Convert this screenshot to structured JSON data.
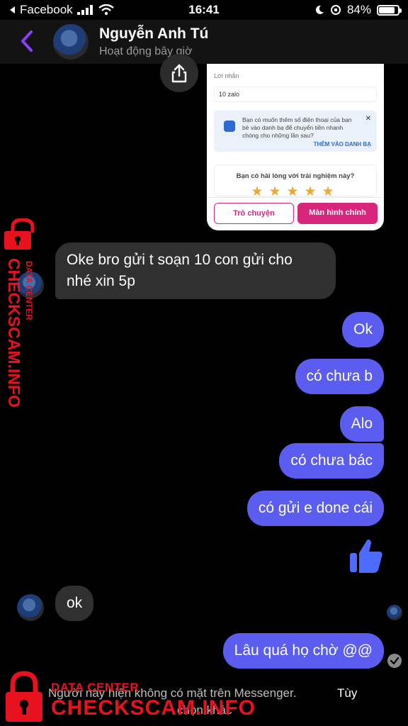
{
  "status_bar": {
    "back_app": "Facebook",
    "time": "16:41",
    "battery_percent": "84%",
    "battery_level": 0.84
  },
  "header": {
    "name": "Nguyễn Anh Tú",
    "status": "Hoạt động bây giờ"
  },
  "shared_image": {
    "message_label": "Lời nhắn",
    "message_value": "10 zalo",
    "info_text": "Bạn có muốn thêm số điện thoại của bạn bè vào danh bạ để chuyển tiền nhanh chóng cho những lần sau?",
    "info_link": "THÊM VÀO DANH BẠ",
    "rating_question": "Bạn có hài lòng với trải nghiệm này?",
    "rating_stars": 5,
    "btn_chat": "Trò chuyện",
    "btn_home": "Màn hình chính"
  },
  "messages": [
    {
      "direction": "in",
      "lines": [
        "Oke bro gửi t soạn 10 con gửi cho",
        "nhé xin 5p"
      ]
    },
    {
      "direction": "out",
      "text": "Ok"
    },
    {
      "direction": "out",
      "text": "có chưa b"
    },
    {
      "direction": "out",
      "text": "Alo"
    },
    {
      "direction": "out",
      "text": "có chưa bác"
    },
    {
      "direction": "out",
      "text": "có gửi e done cái"
    },
    {
      "direction": "out",
      "icon": "thumbs-up-icon"
    },
    {
      "direction": "in",
      "text": "ok"
    },
    {
      "direction": "out",
      "text": "Lâu quá họ chờ @@"
    }
  ],
  "footer": {
    "note": "Người này hiện không có mặt trên Messenger.",
    "link": "Tùy",
    "note_cont": "chọn khác"
  },
  "watermark": {
    "line1": "DATA CENTER",
    "line2": "CHECKSCAM.INFO"
  },
  "colors": {
    "outgoing_bubble": "#5b5df0",
    "incoming_bubble": "#303030",
    "accent_purple": "#8a3ffc",
    "watermark_red": "#e8121e",
    "zalopay_pink": "#d9267d"
  }
}
